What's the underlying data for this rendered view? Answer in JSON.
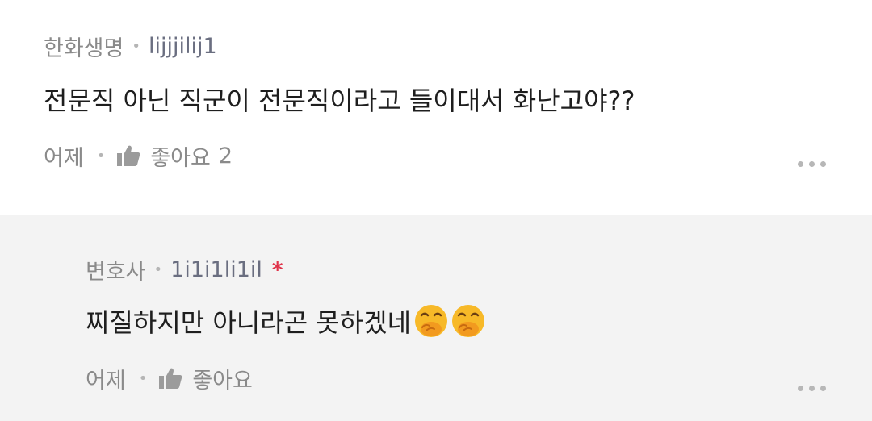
{
  "comments": [
    {
      "category": "한화생명",
      "username": "lijjjilij1",
      "text": "전문직 아닌 직군이 전문직이라고 들이대서 화난고야??",
      "time": "어제",
      "like_label": "좋아요",
      "like_count": "2",
      "icons": {
        "like": "thumbs-up-icon",
        "more": "more-options-icon"
      }
    },
    {
      "category": "변호사",
      "username": "1i1i1li1il",
      "badge": "*",
      "text": "찌질하지만 아니라곤 못하겠네",
      "emojis": [
        "face-with-hand-over-mouth-emoji",
        "face-with-hand-over-mouth-emoji"
      ],
      "time": "어제",
      "like_label": "좋아요",
      "icons": {
        "like": "thumbs-up-icon",
        "more": "more-options-icon"
      }
    }
  ],
  "colors": {
    "meta_gray": "#8a8a8a",
    "username": "#6a6e80",
    "badge_red": "#e0334a",
    "reply_background": "#f3f3f3",
    "text": "#1e1e1e"
  }
}
